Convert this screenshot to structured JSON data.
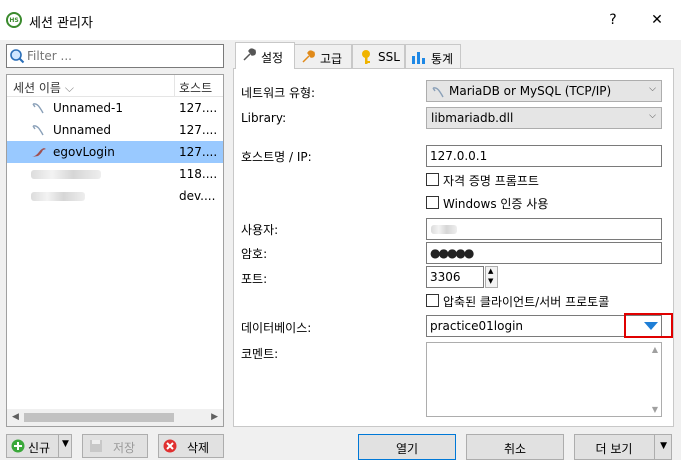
{
  "window": {
    "title": "세션 관리자",
    "app_icon_text": "HS",
    "help_label": "?",
    "close_label": "✕"
  },
  "filter": {
    "placeholder": "Filter ..."
  },
  "tree": {
    "col_name": "세션 이름",
    "col_sort": "⌵",
    "col_host": "호스트",
    "rows": [
      {
        "name": "Unnamed-1",
        "host": "127...."
      },
      {
        "name": "Unnamed",
        "host": "127...."
      },
      {
        "name": "egovLogin",
        "host": "127....",
        "selected": true
      },
      {
        "name": "",
        "host": "118...."
      },
      {
        "name": "",
        "host": "dev...."
      }
    ]
  },
  "left_buttons": {
    "new_label": "신규",
    "save_label": "저장",
    "delete_label": "삭제"
  },
  "tabs": [
    {
      "label": "설정",
      "icon": "wrench-icon"
    },
    {
      "label": "고급",
      "icon": "wrench-orange-icon"
    },
    {
      "label": "SSL",
      "icon": "key-icon"
    },
    {
      "label": "통계",
      "icon": "bar-chart-icon"
    }
  ],
  "form": {
    "network_type_label": "네트워크 유형:",
    "network_type_value": "MariaDB or MySQL (TCP/IP)",
    "library_label": "Library:",
    "library_value": "libmariadb.dll",
    "host_label": "호스트명 / IP:",
    "host_value": "127.0.0.1",
    "cred_prompt_label": "자격 증명 프롬프트",
    "windows_auth_label": "Windows 인증 사용",
    "user_label": "사용자:",
    "password_label": "암호:",
    "password_value": "●●●●●",
    "port_label": "포트:",
    "port_value": "3306",
    "compress_label": "압축된 클라이언트/서버 프로토콜",
    "database_label": "데이터베이스:",
    "database_value": "practice01login",
    "comment_label": "코멘트:"
  },
  "bottom_buttons": {
    "open_label": "열기",
    "cancel_label": "취소",
    "more_label": "더 보기"
  },
  "colors": {
    "selection": "#99c9ff",
    "highlight_box": "#e00000",
    "dropdown_arrow": "#1e7ed6"
  }
}
